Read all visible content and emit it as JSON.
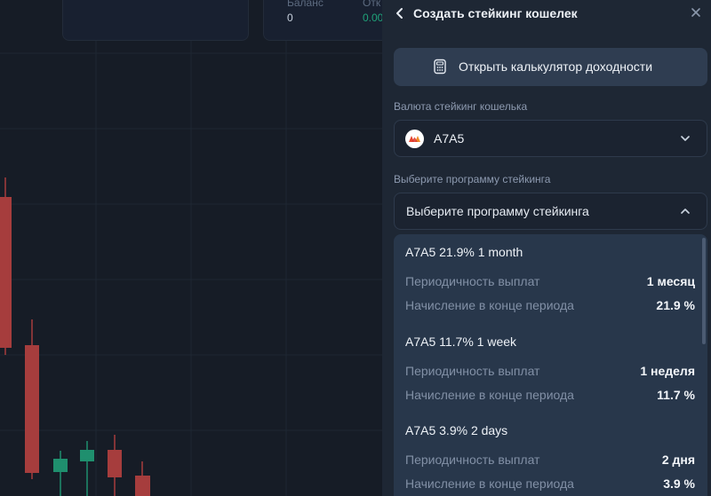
{
  "background_stats": {
    "balance_label": "Баланс",
    "balance_value": "0",
    "second_label": "Отк",
    "second_value": "0.00"
  },
  "panel": {
    "title": "Создать стейкинг кошелек",
    "back_icon": "chevron-left-icon",
    "close_icon": "close-icon"
  },
  "calculator": {
    "label": "Открыть калькулятор доходности",
    "icon": "calculator-icon"
  },
  "currency": {
    "label": "Валюта стейкинг кошелька",
    "selected": "A7A5",
    "icon": "a7a5-coin-icon"
  },
  "program": {
    "label": "Выберите программу стейкинга",
    "placeholder": "Выберите программу стейкинга",
    "expanded": true,
    "options": [
      {
        "title": "A7A5 21.9% 1 month",
        "payout_label": "Периодичность выплат",
        "payout_value": "1 месяц",
        "accrual_label": "Начисление в конце периода",
        "accrual_value": "21.9 %"
      },
      {
        "title": "A7A5 11.7% 1 week",
        "payout_label": "Периодичность выплат",
        "payout_value": "1 неделя",
        "accrual_label": "Начисление в конце периода",
        "accrual_value": "11.7 %"
      },
      {
        "title": "A7A5 3.9% 2 days",
        "payout_label": "Периодичность выплат",
        "payout_value": "2 дня",
        "accrual_label": "Начисление в конце периода",
        "accrual_value": "3.9 %"
      }
    ]
  },
  "colors": {
    "bull": "#1f8f6e",
    "bear": "#a63d3d",
    "panel_bg": "#1e2734",
    "dropdown_bg": "#28374b"
  }
}
